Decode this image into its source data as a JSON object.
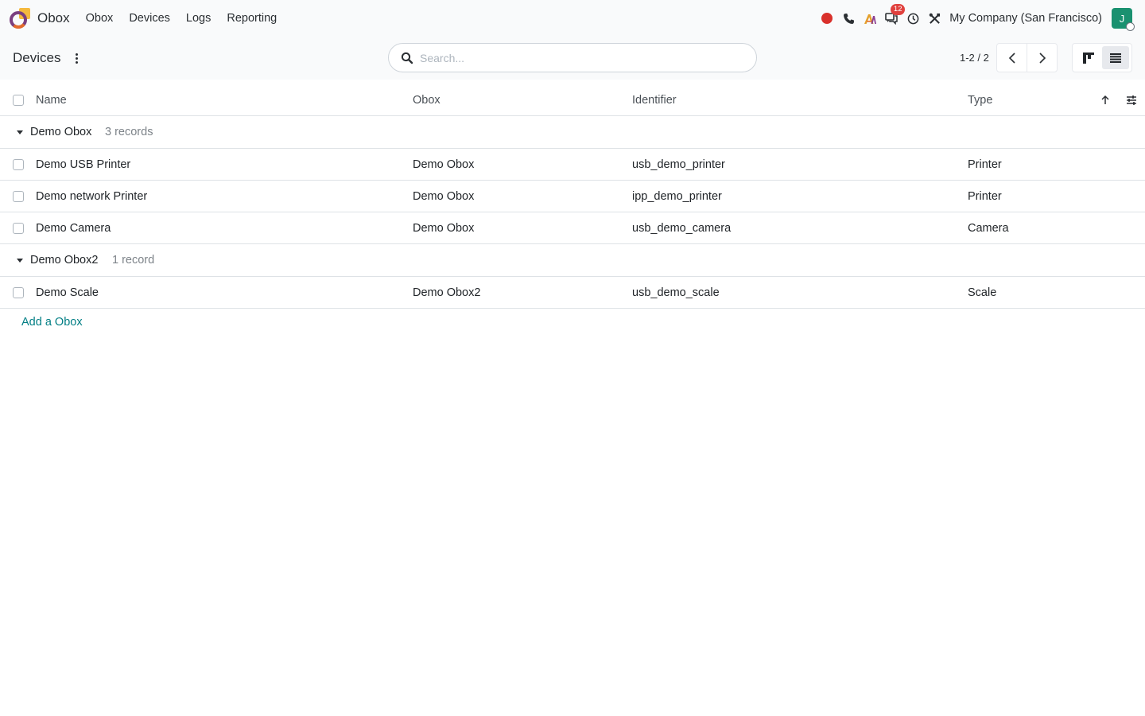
{
  "navbar": {
    "app_name": "Obox",
    "menu": [
      "Obox",
      "Devices",
      "Logs",
      "Reporting"
    ],
    "messages_badge": "12",
    "company": "My Company (San Francisco)",
    "avatar_initial": "J"
  },
  "control_panel": {
    "title": "Devices",
    "search_placeholder": "Search...",
    "pager": "1-2 / 2"
  },
  "list": {
    "columns": [
      "Name",
      "Obox",
      "Identifier",
      "Type"
    ],
    "groups": [
      {
        "name": "Demo Obox",
        "count_label": "3 records",
        "rows": [
          {
            "name": "Demo USB Printer",
            "obox": "Demo Obox",
            "identifier": "usb_demo_printer",
            "type": "Printer"
          },
          {
            "name": "Demo network Printer",
            "obox": "Demo Obox",
            "identifier": "ipp_demo_printer",
            "type": "Printer"
          },
          {
            "name": "Demo Camera",
            "obox": "Demo Obox",
            "identifier": "usb_demo_camera",
            "type": "Camera"
          }
        ]
      },
      {
        "name": "Demo Obox2",
        "count_label": "1 record",
        "rows": [
          {
            "name": "Demo Scale",
            "obox": "Demo Obox2",
            "identifier": "usb_demo_scale",
            "type": "Scale"
          }
        ]
      }
    ],
    "add_label": "Add a Obox"
  },
  "colors": {
    "accent": "#017e84",
    "avatar": "#1a9170",
    "badge": "#e0413e",
    "record": "#d9302b"
  },
  "icons": [
    "brand-logo-icon",
    "record-icon",
    "phone-icon",
    "ai-icon",
    "chat-icon",
    "clock-icon",
    "tools-icon",
    "search-icon",
    "chevron-left-icon",
    "chevron-right-icon",
    "kanban-icon",
    "list-icon",
    "sort-up-icon",
    "sliders-icon",
    "caret-down-icon"
  ]
}
